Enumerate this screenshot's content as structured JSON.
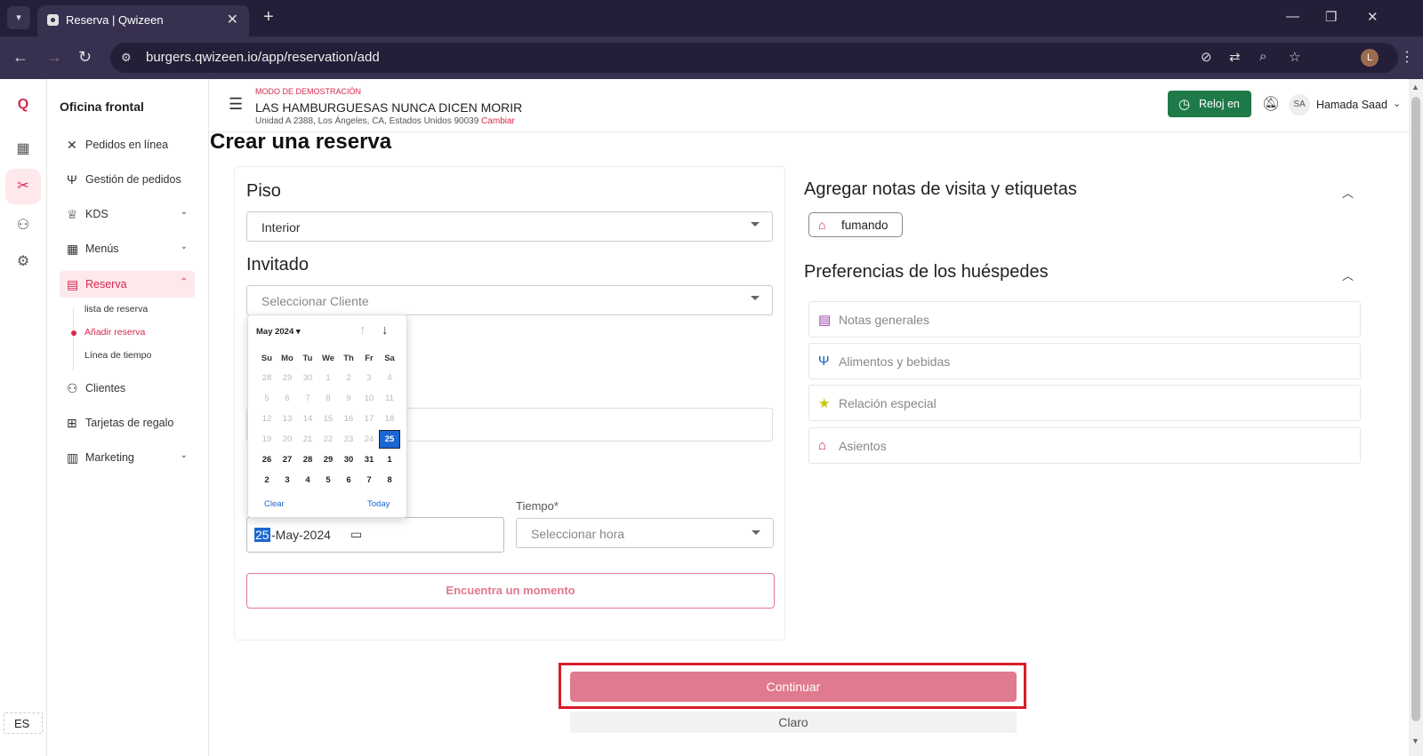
{
  "browser": {
    "tab_title": "Reserva | Qwizeen",
    "url": "burgers.qwizeen.io/app/reservation/add",
    "profile_initial": "L"
  },
  "rail": {
    "lang": "ES"
  },
  "sidebar": {
    "title": "Oficina frontal",
    "items": [
      {
        "label": "Pedidos en línea",
        "icon": "utensils-crossed-icon"
      },
      {
        "label": "Gestión de pedidos",
        "icon": "fork-knife-icon"
      },
      {
        "label": "KDS",
        "icon": "chef-hat-icon"
      },
      {
        "label": "Menús",
        "icon": "grid-icon"
      },
      {
        "label": "Reserva",
        "icon": "table-icon"
      },
      {
        "label": "Clientes",
        "icon": "users-icon"
      },
      {
        "label": "Tarjetas de regalo",
        "icon": "gift-icon"
      },
      {
        "label": "Marketing",
        "icon": "bar-chart-icon"
      }
    ],
    "sub_items": [
      "lista de reserva",
      "Añadir reserva",
      "Línea de tiempo"
    ]
  },
  "header": {
    "demo": "MODO DE DEMOSTRACIÓN",
    "restaurant": "LAS HAMBURGUESAS NUNCA DICEN MORIR",
    "address": "Unidad A 2388, Los Ángeles, CA, Estados Unidos 90039",
    "change": "Cambiar",
    "clock_in": "Reloj en",
    "avatar": "SA",
    "user": "Hamada Saad"
  },
  "page": {
    "title": "Crear una reserva"
  },
  "form": {
    "floor_label": "Piso",
    "floor_value": "Interior",
    "guest_label": "Invitado",
    "guest_placeholder": "Seleccionar Cliente",
    "date_day": "25",
    "date_rest": "-May-2024",
    "time_label": "Tiempo*",
    "time_placeholder": "Seleccionar hora",
    "find_button": "Encuentra un momento"
  },
  "datepicker": {
    "month": "May 2024",
    "weekdays": [
      "Su",
      "Mo",
      "Tu",
      "We",
      "Th",
      "Fr",
      "Sa"
    ],
    "weeks": [
      [
        "28",
        "29",
        "30",
        "1",
        "2",
        "3",
        "4"
      ],
      [
        "5",
        "6",
        "7",
        "8",
        "9",
        "10",
        "11"
      ],
      [
        "12",
        "13",
        "14",
        "15",
        "16",
        "17",
        "18"
      ],
      [
        "19",
        "20",
        "21",
        "22",
        "23",
        "24",
        "25"
      ],
      [
        "26",
        "27",
        "28",
        "29",
        "30",
        "31",
        "1"
      ],
      [
        "2",
        "3",
        "4",
        "5",
        "6",
        "7",
        "8"
      ]
    ],
    "clear": "Clear",
    "today": "Today"
  },
  "notes": {
    "title": "Agregar notas de visita y etiquetas",
    "tag": "fumando"
  },
  "preferences": {
    "title": "Preferencias de los huéspedes",
    "items": [
      {
        "label": "Notas generales",
        "icon": "notes-icon",
        "color": "#9b3fb0"
      },
      {
        "label": "Alimentos y bebidas",
        "icon": "fork-knife-icon",
        "color": "#1a5fb4"
      },
      {
        "label": "Relación especial",
        "icon": "star-icon",
        "color": "#c7c400"
      },
      {
        "label": "Asientos",
        "icon": "house-icon",
        "color": "#d8284b"
      }
    ]
  },
  "actions": {
    "continue": "Continuar",
    "clear": "Claro"
  },
  "colors": {
    "accent": "#d8284b",
    "clock_green": "#1f7a4a",
    "continue_pink": "#e07a8e"
  }
}
